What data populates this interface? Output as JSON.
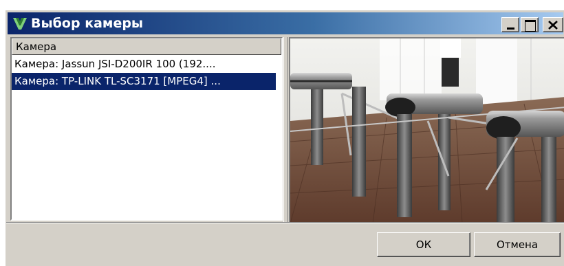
{
  "window": {
    "title": "Выбор камеры",
    "minimize_icon": "minimize-icon",
    "maximize_icon": "maximize-icon",
    "close_icon": "close-icon",
    "app_icon": "parsec-logo-icon"
  },
  "camera_list": {
    "column_header": "Камера",
    "items": [
      {
        "label": "Камера: Jassun JSI-D200IR 100 (192....",
        "selected": false
      },
      {
        "label": "Камера: TP-LINK TL-SC3171 [MPEG4] ...",
        "selected": true
      }
    ]
  },
  "preview": {
    "content": "camera-preview-image"
  },
  "buttons": {
    "ok_label": "ОК",
    "cancel_label": "Отмена"
  },
  "colors": {
    "titlebar_start": "#0a246a",
    "titlebar_end": "#a6caf0",
    "selection": "#0a246a",
    "face": "#d4d0c8"
  }
}
